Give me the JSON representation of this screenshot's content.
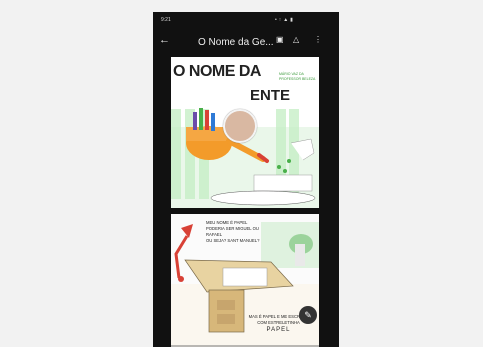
{
  "status_bar": {
    "time": "9:21",
    "system_icons": "• ↑ ▲ ▮"
  },
  "app_bar": {
    "back_icon": "arrow-left-icon",
    "title": "O Nome da Ge...",
    "actions": [
      "document-icon",
      "drive-icon",
      "more-icon"
    ]
  },
  "page1": {
    "title_line1": "O NOME DA",
    "title_line2": "ENTE",
    "authors": [
      "MÁRIO VAZ DA",
      "PROFESSOR BELEZA"
    ]
  },
  "page2": {
    "speech_top": [
      "MEU NOME É PAPEL",
      "PODERIA SER MIGUEL OU RAFAEL",
      "OU SEJA? SANT MANUEL?"
    ],
    "speech_bottom": [
      "MAS É PAPEL E ME ESCREVE",
      "COM ESTRELETINHA",
      "PAPEL"
    ]
  },
  "fab": {
    "icon": "edit-icon"
  },
  "colors": {
    "background": "#f2f2f2",
    "phone": "#111111",
    "green": "#49b04a",
    "orange": "#f39b2a",
    "red": "#d84136"
  }
}
